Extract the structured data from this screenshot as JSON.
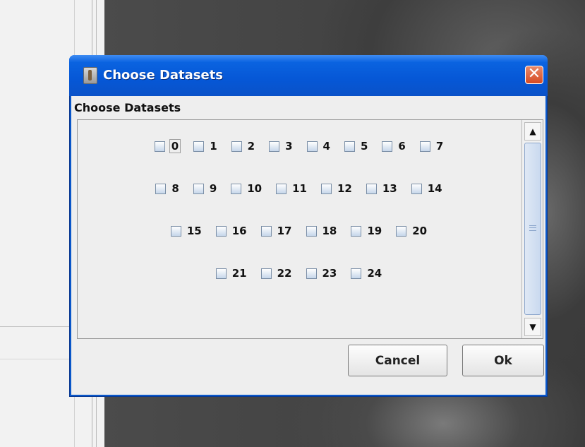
{
  "window": {
    "title": "Choose Datasets",
    "close_glyph": "✕"
  },
  "dialog": {
    "header": "Choose Datasets",
    "checkboxes": [
      [
        "0",
        "1",
        "2",
        "3",
        "4",
        "5",
        "6",
        "7"
      ],
      [
        "8",
        "9",
        "10",
        "11",
        "12",
        "13",
        "14"
      ],
      [
        "15",
        "16",
        "17",
        "18",
        "19",
        "20"
      ],
      [
        "21",
        "22",
        "23",
        "24"
      ]
    ],
    "focused": "0",
    "scroll_up_glyph": "▲",
    "scroll_down_glyph": "▼"
  },
  "buttons": {
    "cancel": "Cancel",
    "ok": "Ok"
  },
  "icons": {
    "app": "app-icon",
    "close": "close-icon"
  },
  "colors": {
    "titlebar": "#0657d6",
    "close": "#d64a22",
    "dialog_bg": "#eeeeee"
  }
}
